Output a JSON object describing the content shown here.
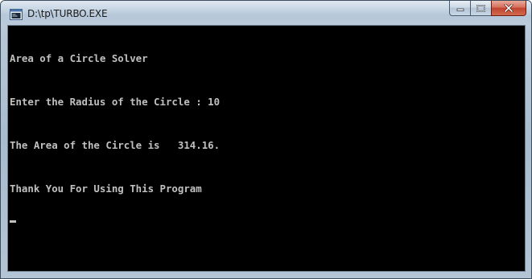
{
  "window": {
    "title": "D:\\tp\\TURBO.EXE",
    "app_icon": "console-app-icon"
  },
  "caption_buttons": {
    "minimize_icon": "minimize-icon",
    "maximize_icon": "maximize-icon",
    "close_icon": "close-icon",
    "close_color": "#c24430"
  },
  "console": {
    "background": "#000000",
    "foreground": "#c0c0c0",
    "lines": [
      "Area of a Circle Solver",
      "Enter the Radius of the Circle : 10",
      "The Area of the Circle is   314.16.",
      "Thank You For Using This Program"
    ]
  }
}
